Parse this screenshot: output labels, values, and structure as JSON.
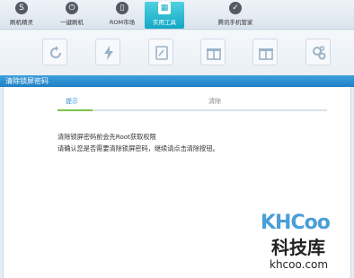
{
  "nav": {
    "items": [
      {
        "label": "刷机精灵",
        "icon": "gear-s-icon"
      },
      {
        "label": "一键刷机",
        "icon": "power-icon"
      },
      {
        "label": "ROM市场",
        "icon": "phone-icon"
      },
      {
        "label": "实用工具",
        "icon": "grid-icon"
      },
      {
        "label": "腾讯手机管家",
        "icon": "shield-icon"
      }
    ],
    "active_index": 3
  },
  "tools": [
    {
      "icon": "refresh-icon"
    },
    {
      "icon": "lightning-icon"
    },
    {
      "icon": "document-icon"
    },
    {
      "icon": "gift-icon"
    },
    {
      "icon": "gift-icon"
    },
    {
      "icon": "gears-icon"
    }
  ],
  "dialog": {
    "title": "清除锁屏密码",
    "steps": [
      {
        "label": "提示"
      },
      {
        "label": "清除"
      }
    ],
    "progress": 0.13,
    "message_line1": "清除锁屏密码前会先Root获取权限",
    "message_line2": "请确认您是否需要清除锁屏密码，继续请点击清除按钮。"
  },
  "watermark": {
    "logo": "KHCoo",
    "name": "科技库",
    "url": "khcoo.com"
  },
  "colors": {
    "accent": "#1f7fc4",
    "active_nav": "#13a8c4",
    "progress": "#7cc24a"
  }
}
